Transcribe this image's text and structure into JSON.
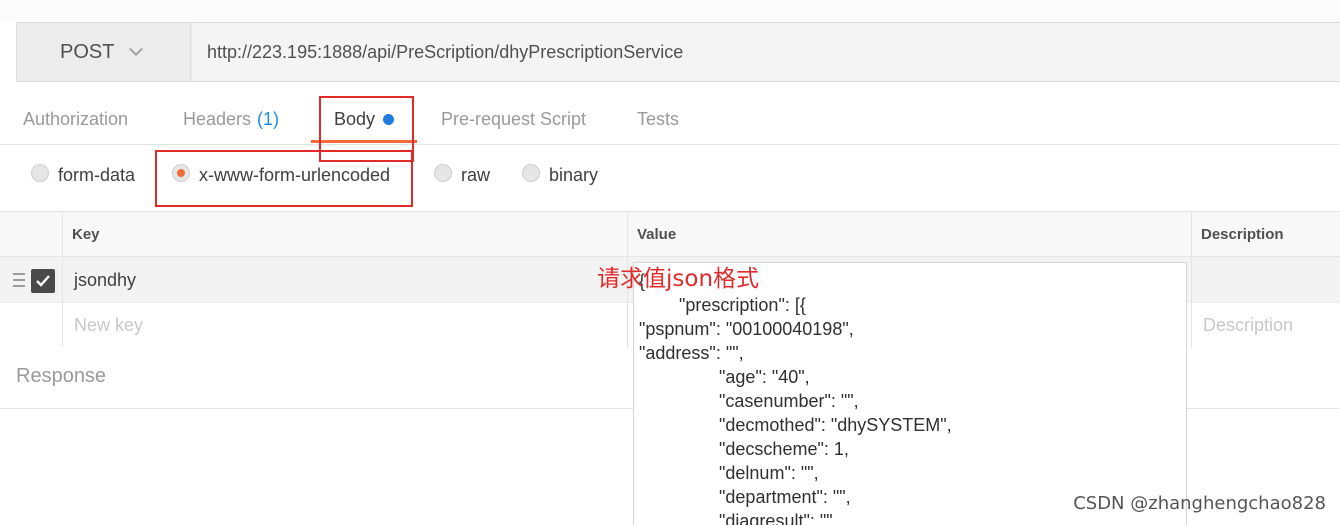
{
  "request": {
    "method": "POST",
    "url": "http://223.195:1888/api/PreScription/dhyPrescriptionService"
  },
  "tabs": [
    {
      "label": "Authorization"
    },
    {
      "label": "Headers",
      "count": "(1)"
    },
    {
      "label": "Body"
    },
    {
      "label": "Pre-request Script"
    },
    {
      "label": "Tests"
    }
  ],
  "body_types": [
    {
      "label": "form-data",
      "selected": false
    },
    {
      "label": "x-www-form-urlencoded",
      "selected": true
    },
    {
      "label": "raw",
      "selected": false
    },
    {
      "label": "binary",
      "selected": false
    }
  ],
  "table": {
    "headers": {
      "key": "Key",
      "value": "Value",
      "description": "Description"
    },
    "rows": [
      {
        "key": "jsondhy",
        "checked": true
      }
    ],
    "placeholders": {
      "key": "New key",
      "description": "Description"
    }
  },
  "response_label": "Response",
  "value_editor": "{\n        \"prescription\": [{\n\"pspnum\": \"00100040198\",\n\"address\": \"\",\n                \"age\": \"40\",\n                \"casenumber\": \"\",\n                \"decmothed\": \"dhySYSTEM\",\n                \"decscheme\": 1,\n                \"delnum\": \"\",\n                \"department\": \"\",\n                \"diagresult\": \"\",",
  "annotation": "请求值json格式",
  "watermark": "CSDN @zhanghengchao828",
  "colors": {
    "accent_orange": "#f26b3a",
    "link_blue": "#1e8ce0",
    "annotation_red": "#e02b2b"
  }
}
